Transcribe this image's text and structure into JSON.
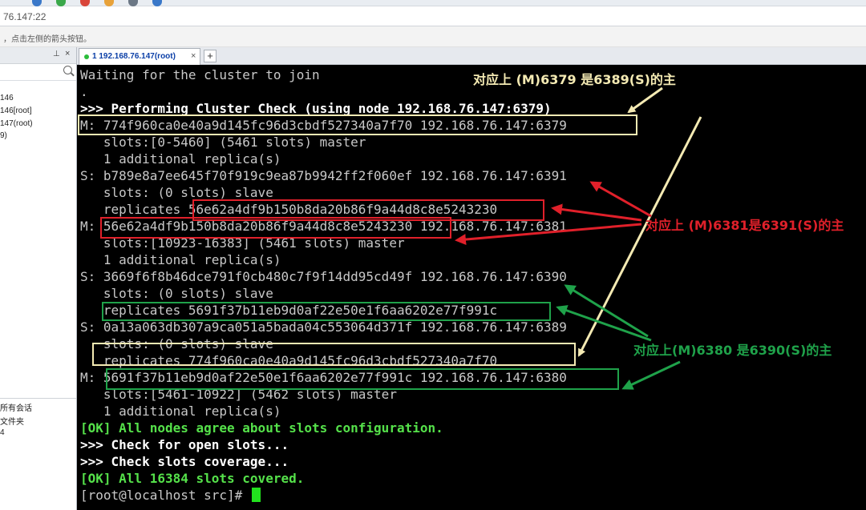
{
  "window": {
    "address_text": "76.147:22",
    "hint_text": "，点击左侧的箭头按钮。"
  },
  "left_panel": {
    "tree_items": [
      "146",
      "146[root]",
      "147(root)",
      "9)"
    ],
    "bottom_items": [
      "所有会话",
      "文件夹",
      "4"
    ]
  },
  "tabs": [
    {
      "label": "1 192.168.76.147(root)"
    }
  ],
  "terminal": {
    "lines": [
      "Waiting for the cluster to join",
      ".",
      ">>> Performing Cluster Check (using node 192.168.76.147:6379)",
      "M: 774f960ca0e40a9d145fc96d3cbdf527340a7f70 192.168.76.147:6379",
      "   slots:[0-5460] (5461 slots) master",
      "   1 additional replica(s)",
      "S: b789e8a7ee645f70f919c9ea87b9942ff2f060ef 192.168.76.147:6391",
      "   slots: (0 slots) slave",
      "   replicates 56e62a4df9b150b8da20b86f9a44d8c8e5243230",
      "M: 56e62a4df9b150b8da20b86f9a44d8c8e5243230 192.168.76.147:6381",
      "   slots:[10923-16383] (5461 slots) master",
      "   1 additional replica(s)",
      "S: 3669f6f8b46dce791f0cb480c7f9f14dd95cd49f 192.168.76.147:6390",
      "   slots: (0 slots) slave",
      "   replicates 5691f37b11eb9d0af22e50e1f6aa6202e77f991c",
      "S: 0a13a063db307a9ca051a5bada04c553064d371f 192.168.76.147:6389",
      "   slots: (0 slots) slave",
      "   replicates 774f960ca0e40a9d145fc96d3cbdf527340a7f70",
      "M: 5691f37b11eb9d0af22e50e1f6aa6202e77f991c 192.168.76.147:6380",
      "   slots:[5461-10922] (5462 slots) master",
      "   1 additional replica(s)",
      "[OK] All nodes agree about slots configuration.",
      ">>> Check for open slots...",
      ">>> Check slots coverage...",
      "[OK] All 16384 slots covered.",
      "[root@localhost src]# "
    ]
  },
  "annotations": {
    "a1": "对应上 (M)6379 是6389(S)的主",
    "a2": "对应上 (M)6381是6391(S)的主",
    "a3": "对应上(M)6380 是6390(S)的主"
  },
  "colors": {
    "terminal_bg": "#000000",
    "terminal_text": "#c8c8c8",
    "ok_green": "#55e14a",
    "annot_yellow": "#f4eab3",
    "annot_red": "#e0202a",
    "annot_green": "#1fa24a"
  }
}
